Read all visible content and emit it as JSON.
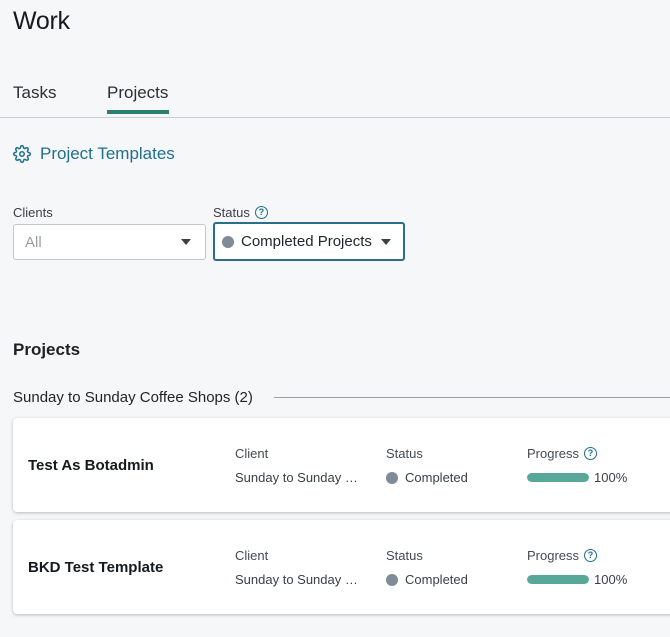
{
  "page": {
    "title": "Work"
  },
  "tabs": [
    {
      "label": "Tasks",
      "active": false
    },
    {
      "label": "Projects",
      "active": true
    }
  ],
  "templates_link": {
    "label": "Project Templates",
    "icon": "gear-icon"
  },
  "filters": {
    "clients": {
      "label": "Clients",
      "value": "All"
    },
    "status": {
      "label": "Status",
      "value": "Completed Projects",
      "help_icon": "help-icon"
    }
  },
  "projects_section": {
    "title": "Projects",
    "groups": [
      {
        "header": "Sunday to Sunday Coffee Shops (2)",
        "projects": [
          {
            "name": "Test As Botadmin",
            "client_label": "Client",
            "client": "Sunday to Sunday Coffee Shops",
            "status_label": "Status",
            "status": "Completed",
            "progress_label": "Progress",
            "progress_text": "100%",
            "progress": 1.0
          },
          {
            "name": "BKD Test Template",
            "client_label": "Client",
            "client": "Sunday to Sunday Coffee Shops",
            "status_label": "Status",
            "status": "Completed",
            "progress_label": "Progress",
            "progress_text": "100%",
            "progress": 1.0
          }
        ]
      }
    ]
  },
  "colors": {
    "accent": "#2e7f70",
    "link": "#1f6f8d",
    "status_completed": "#808b98",
    "progress_fill": "#58a899"
  }
}
